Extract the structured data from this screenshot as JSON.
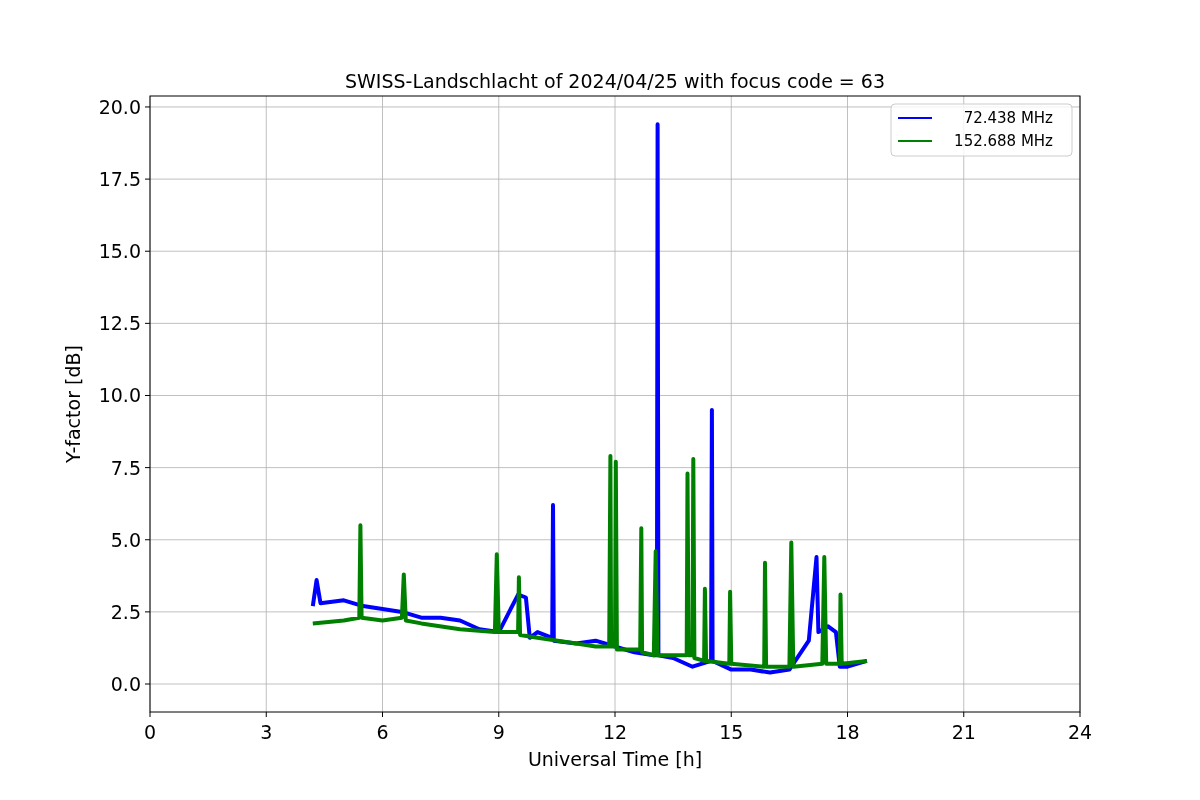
{
  "figure": {
    "chart_data": {
      "type": "line",
      "title": "SWISS-Landschlacht of 2024/04/25 with focus code = 63",
      "xlabel": "Universal Time [h]",
      "ylabel": "Y-factor [dB]",
      "grid": true,
      "legend": "upper right",
      "xlim": [
        0,
        24
      ],
      "ylim": [
        -0.97,
        20.38
      ],
      "xticks": [
        0,
        3,
        6,
        9,
        12,
        15,
        18,
        21,
        24
      ],
      "yticks": [
        {
          "value": 0,
          "label": "0.0"
        },
        {
          "value": 2.5,
          "label": "2.5"
        },
        {
          "value": 5,
          "label": "5.0"
        },
        {
          "value": 7.5,
          "label": "7.5"
        },
        {
          "value": 10,
          "label": "10.0"
        },
        {
          "value": 12.5,
          "label": "12.5"
        },
        {
          "value": 15,
          "label": "15.0"
        },
        {
          "value": 17.5,
          "label": "17.5"
        },
        {
          "value": 20,
          "label": "20.0"
        }
      ],
      "series": [
        {
          "name": "72.438 MHz",
          "color": "#0000ff",
          "x": [
            4.2,
            4.3,
            4.4,
            5.0,
            5.5,
            6.0,
            6.5,
            7.0,
            7.5,
            8.0,
            8.5,
            9.0,
            9.5,
            9.7,
            9.8,
            10.0,
            10.38,
            10.4,
            10.42,
            11.0,
            11.5,
            12.0,
            12.5,
            13.0,
            13.08,
            13.1,
            13.12,
            13.5,
            14.0,
            14.48,
            14.5,
            14.52,
            15.0,
            15.5,
            16.0,
            16.5,
            17.0,
            17.2,
            17.25,
            17.5,
            17.7,
            17.8,
            18.0,
            18.5
          ],
          "values": [
            2.7,
            3.6,
            2.8,
            2.9,
            2.7,
            2.6,
            2.5,
            2.3,
            2.3,
            2.2,
            1.9,
            1.8,
            3.1,
            3.0,
            1.6,
            1.8,
            1.6,
            6.2,
            1.5,
            1.4,
            1.5,
            1.3,
            1.1,
            1.0,
            1.0,
            19.4,
            1.0,
            0.9,
            0.6,
            0.8,
            9.5,
            0.8,
            0.5,
            0.5,
            0.4,
            0.5,
            1.5,
            4.4,
            1.8,
            2.0,
            1.8,
            0.6,
            0.6,
            0.8
          ]
        },
        {
          "name": "152.688 MHz",
          "color": "#008000",
          "x": [
            4.2,
            5.0,
            5.4,
            5.43,
            5.46,
            6.0,
            6.5,
            6.55,
            6.6,
            7.0,
            8.0,
            8.9,
            8.95,
            9.0,
            9.5,
            9.52,
            9.55,
            10.0,
            11.0,
            11.5,
            11.85,
            11.88,
            11.9,
            12.0,
            12.02,
            12.05,
            12.65,
            12.68,
            12.7,
            13.0,
            13.05,
            13.1,
            13.85,
            13.87,
            13.9,
            14.0,
            14.02,
            14.05,
            14.3,
            14.32,
            14.35,
            14.95,
            14.97,
            15.0,
            15.85,
            15.87,
            15.9,
            16.5,
            16.55,
            16.6,
            17.35,
            17.4,
            17.45,
            17.8,
            17.82,
            17.85,
            18.5
          ],
          "values": [
            2.1,
            2.2,
            2.3,
            5.5,
            2.3,
            2.2,
            2.3,
            3.8,
            2.2,
            2.1,
            1.9,
            1.8,
            4.5,
            1.8,
            1.8,
            3.7,
            1.7,
            1.6,
            1.4,
            1.3,
            1.3,
            7.9,
            1.3,
            1.3,
            7.7,
            1.2,
            1.2,
            5.4,
            1.1,
            1.0,
            4.6,
            1.0,
            1.0,
            7.3,
            1.0,
            1.0,
            7.8,
            0.9,
            0.8,
            3.3,
            0.8,
            0.7,
            3.2,
            0.7,
            0.6,
            4.2,
            0.6,
            0.6,
            4.9,
            0.6,
            0.7,
            4.4,
            0.7,
            0.7,
            3.1,
            0.7,
            0.8
          ]
        }
      ]
    }
  }
}
